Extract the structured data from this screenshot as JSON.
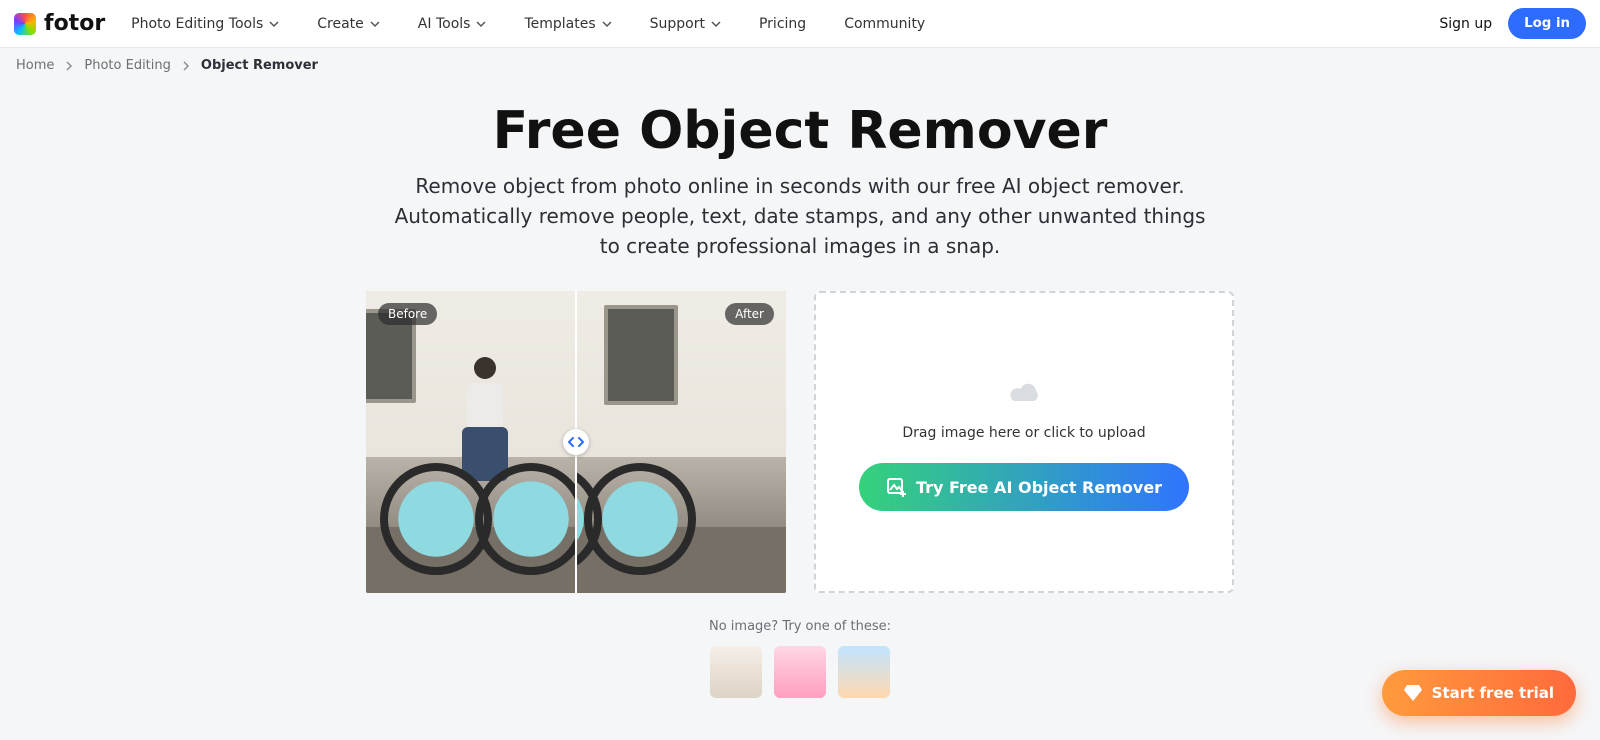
{
  "brand": {
    "name": "fotor"
  },
  "nav": {
    "items": [
      {
        "label": "Photo Editing Tools",
        "dropdown": true
      },
      {
        "label": "Create",
        "dropdown": true
      },
      {
        "label": "AI Tools",
        "dropdown": true
      },
      {
        "label": "Templates",
        "dropdown": true
      },
      {
        "label": "Support",
        "dropdown": true
      },
      {
        "label": "Pricing",
        "dropdown": false
      },
      {
        "label": "Community",
        "dropdown": false
      }
    ],
    "signup": "Sign up",
    "login": "Log in"
  },
  "breadcrumb": {
    "items": [
      "Home",
      "Photo Editing",
      "Object Remover"
    ]
  },
  "hero": {
    "title": "Free Object Remover",
    "subtitle": "Remove object from photo online in seconds with our free AI object remover. Automatically remove people, text, date stamps, and any other unwanted things to create professional images in a snap."
  },
  "compare": {
    "before_label": "Before",
    "after_label": "After"
  },
  "upload": {
    "hint": "Drag image here or click to upload",
    "cta": "Try Free AI Object Remover"
  },
  "samples": {
    "hint": "No image? Try one of these:"
  },
  "trial": {
    "label": "Start free trial"
  }
}
